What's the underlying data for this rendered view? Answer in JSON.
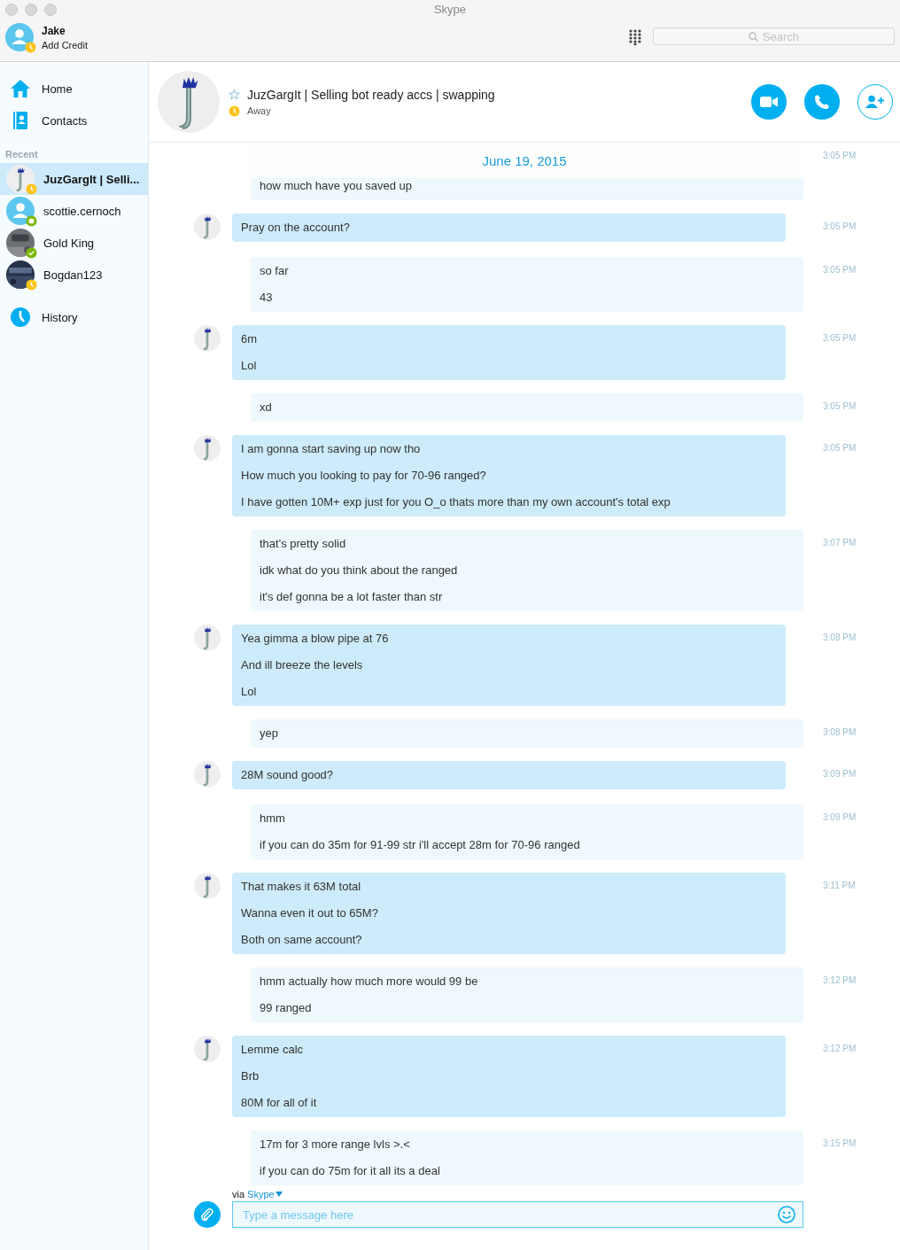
{
  "window": {
    "title": "Skype"
  },
  "account": {
    "name": "Jake",
    "credit": "Add Credit",
    "badge": {
      "kind": "away",
      "color": "#fcc419"
    }
  },
  "search": {
    "placeholder": "Search"
  },
  "nav": [
    {
      "label": "Home",
      "kind": "home"
    },
    {
      "label": "Contacts",
      "kind": "contacts"
    }
  ],
  "recent": {
    "heading": "Recent",
    "items": [
      {
        "name": "JuzGargIt | Selli...",
        "kind": "stick",
        "badge": {
          "kind": "away",
          "color": "#fcc419"
        },
        "selected": true
      },
      {
        "name": "scottie.cernoch",
        "kind": "default",
        "badge": {
          "kind": "ring",
          "color": "#7ab800"
        },
        "selected": false
      },
      {
        "name": "Gold King",
        "kind": "picture",
        "badge": {
          "kind": "online",
          "color": "#7ab800"
        },
        "selected": false
      },
      {
        "name": "Bogdan123",
        "kind": "picture",
        "badge": {
          "kind": "away",
          "color": "#fcc419"
        },
        "selected": false
      }
    ]
  },
  "history": {
    "label": "History"
  },
  "chat": {
    "title": "JuzGargIt | Selling bot ready accs | swapping",
    "status": "Away",
    "badge": {
      "kind": "away",
      "color": "#fcc419"
    },
    "favorite": false,
    "date_banner": "June 19, 2015",
    "messages": [
      {
        "kind": "me",
        "time": "3:05 PM",
        "lines": [
          "how much have you saved up"
        ]
      },
      {
        "kind": "them",
        "time": "3:05 PM",
        "lines": [
          "Pray on the account?"
        ]
      },
      {
        "kind": "me",
        "time": "3:05 PM",
        "lines": [
          "so far",
          "43"
        ]
      },
      {
        "kind": "them",
        "time": "3:05 PM",
        "lines": [
          "6m",
          "Lol"
        ]
      },
      {
        "kind": "me",
        "time": "3:05 PM",
        "lines": [
          "xd"
        ]
      },
      {
        "kind": "them",
        "time": "3:05 PM",
        "lines": [
          "I am gonna start saving up now tho",
          "How much you looking to pay for 70-96 ranged?",
          "I have gotten 10M+ exp just for you O_o thats more than my own account's total exp"
        ]
      },
      {
        "kind": "me",
        "time": "3:07 PM",
        "lines": [
          "that's pretty solid",
          "idk what do you think about the ranged",
          "it's def gonna be a lot faster than str"
        ]
      },
      {
        "kind": "them",
        "time": "3:08 PM",
        "lines": [
          "Yea gimma a blow pipe at 76",
          "And ill breeze the levels",
          "Lol"
        ]
      },
      {
        "kind": "me",
        "time": "3:08 PM",
        "lines": [
          "yep"
        ]
      },
      {
        "kind": "them",
        "time": "3:09 PM",
        "lines": [
          "28M sound good?"
        ]
      },
      {
        "kind": "me",
        "time": "3:09 PM",
        "lines": [
          "hmm",
          "if you can do 35m for 91-99 str i'll accept 28m for 70-96 ranged"
        ]
      },
      {
        "kind": "them",
        "time": "3:11 PM",
        "lines": [
          "That makes it 63M total",
          "Wanna even it out to 65M?",
          "Both on same account?"
        ]
      },
      {
        "kind": "me",
        "time": "3:12 PM",
        "lines": [
          "hmm actually how much more would 99 be",
          "99 ranged"
        ]
      },
      {
        "kind": "them",
        "time": "3:12 PM",
        "lines": [
          "Lemme calc",
          "Brb",
          "80M for all of it"
        ]
      },
      {
        "kind": "me",
        "time": "3:15 PM",
        "lines": [
          "17m for 3 more range lvls >.<",
          "if you can do 75m for it all its a deal"
        ]
      }
    ]
  },
  "composer": {
    "via": "via",
    "service": "Skype",
    "placeholder": "Type a message here"
  }
}
